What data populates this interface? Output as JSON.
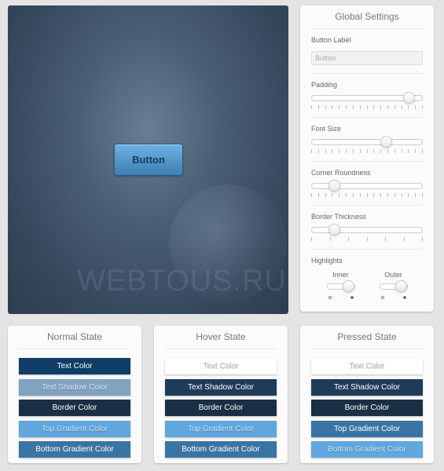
{
  "preview": {
    "button_label": "Button",
    "watermark": "WEBTOUS.RU"
  },
  "global_settings": {
    "title": "Global Settings",
    "button_label": {
      "label": "Button Label",
      "value": "Button"
    },
    "padding": {
      "label": "Padding",
      "value": 0.88,
      "ticks": 17
    },
    "font_size": {
      "label": "Font Size",
      "value": 0.67,
      "ticks": 17
    },
    "corner_roundness": {
      "label": "Corner Roundness",
      "value": 0.2,
      "ticks": 17
    },
    "border_thickness": {
      "label": "Border Thickness",
      "value": 0.2,
      "ticks": 7
    },
    "highlights": {
      "label": "Highlights",
      "inner": {
        "label": "Inner",
        "on": true
      },
      "outer": {
        "label": "Outer",
        "on": true
      }
    }
  },
  "states": [
    {
      "title": "Normal State",
      "swatches": [
        {
          "label": "Text Color",
          "bg": "#0f3d66",
          "fg": "#ffffff"
        },
        {
          "label": "Text Shadow Color",
          "bg": "#7fa3c0",
          "fg": "#dfe9f1"
        },
        {
          "label": "Border Color",
          "bg": "#1a2f44",
          "fg": "#ffffff"
        },
        {
          "label": "Top Gradient Color",
          "bg": "#5fa7dc",
          "fg": "#cfe5f5"
        },
        {
          "label": "Bottom Gradient Color",
          "bg": "#3a74a3",
          "fg": "#ffffff"
        }
      ]
    },
    {
      "title": "Hover State",
      "swatches": [
        {
          "label": "Text Color",
          "bg": "#ffffff",
          "fg": "#bbbbbb"
        },
        {
          "label": "Text Shadow Color",
          "bg": "#1e3c5a",
          "fg": "#ffffff"
        },
        {
          "label": "Border Color",
          "bg": "#1a2f44",
          "fg": "#ffffff"
        },
        {
          "label": "Top Gradient Color",
          "bg": "#5fa7dc",
          "fg": "#cfe5f5"
        },
        {
          "label": "Bottom Gradient Color",
          "bg": "#3a74a3",
          "fg": "#ffffff"
        }
      ]
    },
    {
      "title": "Pressed State",
      "swatches": [
        {
          "label": "Text Color",
          "bg": "#ffffff",
          "fg": "#bbbbbb"
        },
        {
          "label": "Text Shadow Color",
          "bg": "#1e3c5a",
          "fg": "#ffffff"
        },
        {
          "label": "Border Color",
          "bg": "#1a2f44",
          "fg": "#ffffff"
        },
        {
          "label": "Top Gradient Color",
          "bg": "#3a74a3",
          "fg": "#ffffff"
        },
        {
          "label": "Bottom Gradient Color",
          "bg": "#5fa7dc",
          "fg": "#cfe5f5"
        }
      ]
    }
  ]
}
